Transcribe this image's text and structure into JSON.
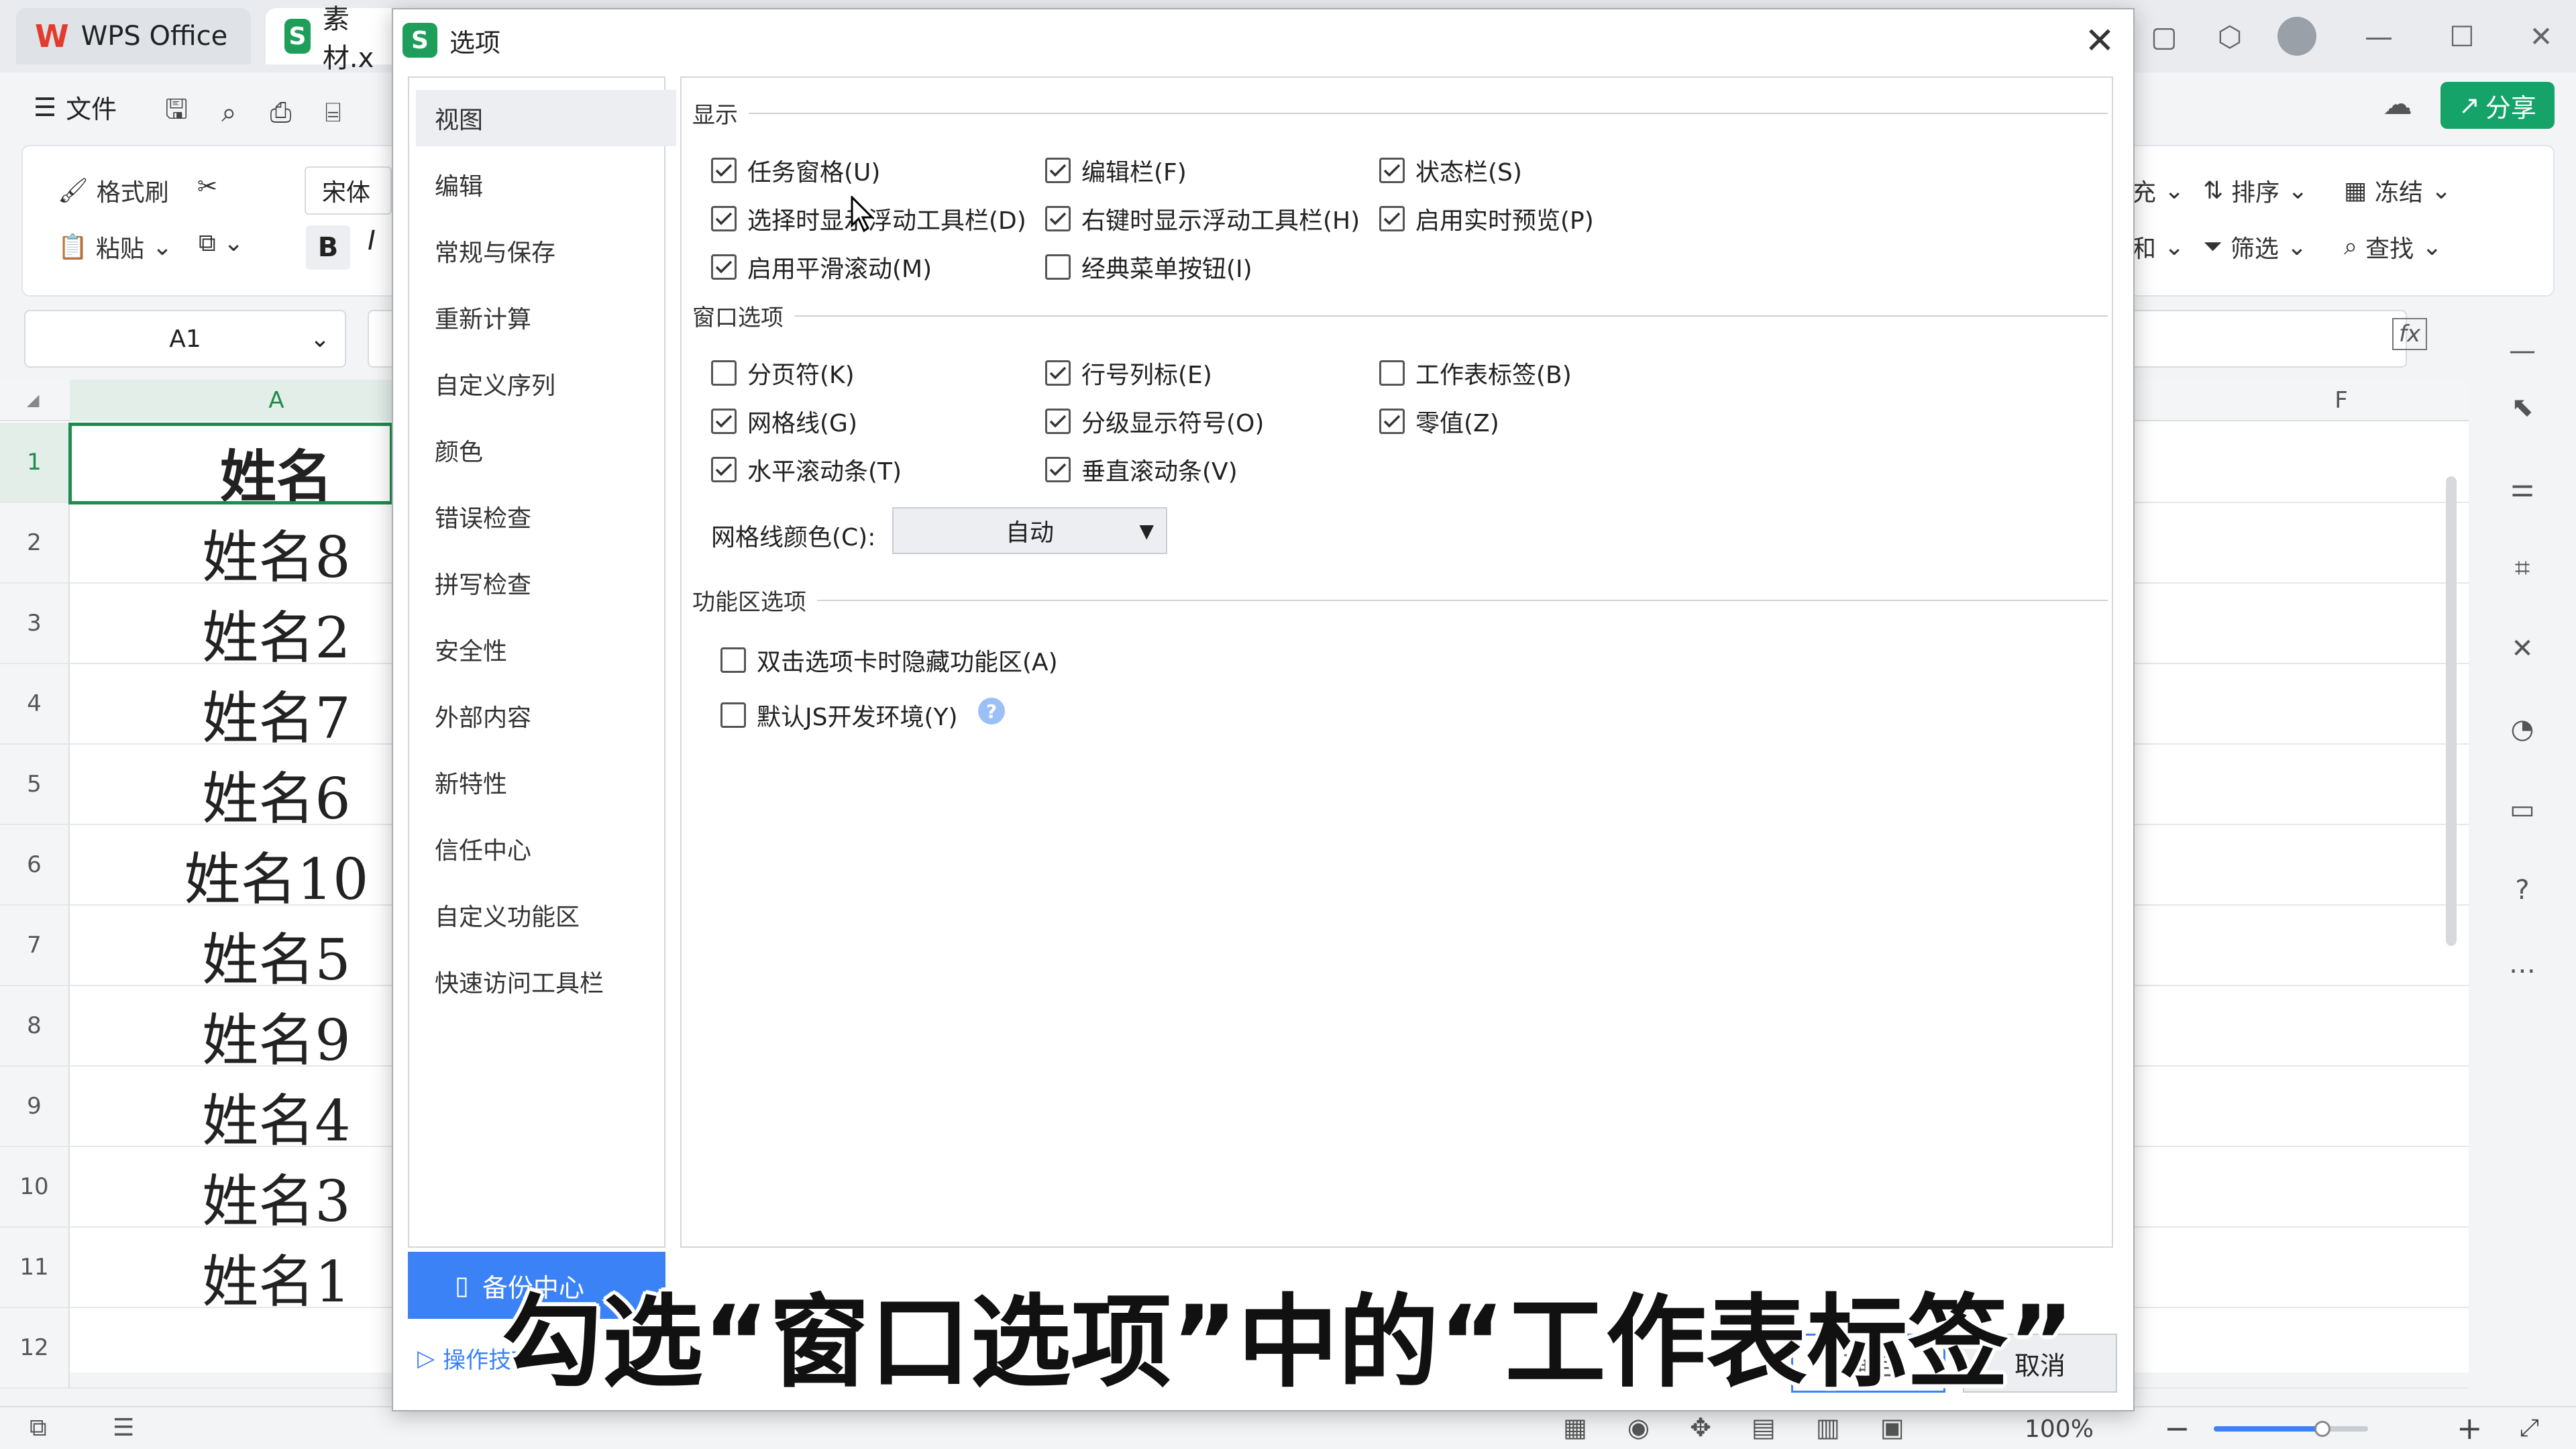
{
  "app": {
    "tabs": [
      {
        "label": "WPS Office"
      },
      {
        "label": "素材.x"
      }
    ],
    "menu_label": "文件",
    "share_label": "分享"
  },
  "ribbon": {
    "format_painter": "格式刷",
    "paste": "粘贴",
    "font_name": "宋体",
    "bold": "B",
    "italic": "I",
    "sort": "排序",
    "freeze": "冻结",
    "filter": "筛选",
    "find": "查找",
    "clipped1": "充",
    "clipped2": "和"
  },
  "formula_bar": {
    "name_box": "A1",
    "fx": "fx"
  },
  "sheet": {
    "col_a": "A",
    "col_f": "F",
    "rows": [
      {
        "num": "1",
        "value": "姓名"
      },
      {
        "num": "2",
        "value": "姓名8"
      },
      {
        "num": "3",
        "value": "姓名2"
      },
      {
        "num": "4",
        "value": "姓名7"
      },
      {
        "num": "5",
        "value": "姓名6"
      },
      {
        "num": "6",
        "value": "姓名10"
      },
      {
        "num": "7",
        "value": "姓名5"
      },
      {
        "num": "8",
        "value": "姓名9"
      },
      {
        "num": "9",
        "value": "姓名4"
      },
      {
        "num": "10",
        "value": "姓名3"
      },
      {
        "num": "11",
        "value": "姓名1"
      },
      {
        "num": "12",
        "value": ""
      }
    ]
  },
  "status": {
    "zoom": "100%"
  },
  "dialog": {
    "title": "选项",
    "nav": [
      "视图",
      "编辑",
      "常规与保存",
      "重新计算",
      "自定义序列",
      "颜色",
      "错误检查",
      "拼写检查",
      "安全性",
      "外部内容",
      "新特性",
      "信任中心",
      "自定义功能区",
      "快速访问工具栏"
    ],
    "backup_label": "备份中心",
    "tips_label": "操作技巧",
    "sections": {
      "display": "显示",
      "window": "窗口选项",
      "ribbon": "功能区选项"
    },
    "display_options": [
      {
        "label": "任务窗格(U)",
        "checked": true
      },
      {
        "label": "编辑栏(F)",
        "checked": true
      },
      {
        "label": "状态栏(S)",
        "checked": true
      },
      {
        "label": "选择时显示浮动工具栏(D)",
        "checked": true
      },
      {
        "label": "右键时显示浮动工具栏(H)",
        "checked": true
      },
      {
        "label": "启用实时预览(P)",
        "checked": true
      },
      {
        "label": "启用平滑滚动(M)",
        "checked": true
      },
      {
        "label": "经典菜单按钮(I)",
        "checked": false
      }
    ],
    "window_options": [
      {
        "label": "分页符(K)",
        "checked": false
      },
      {
        "label": "行号列标(E)",
        "checked": true
      },
      {
        "label": "工作表标签(B)",
        "checked": false
      },
      {
        "label": "网格线(G)",
        "checked": true
      },
      {
        "label": "分级显示符号(O)",
        "checked": true
      },
      {
        "label": "零值(Z)",
        "checked": true
      },
      {
        "label": "水平滚动条(T)",
        "checked": true
      },
      {
        "label": "垂直滚动条(V)",
        "checked": true
      }
    ],
    "gridline_color_label": "网格线颜色(C):",
    "gridline_color_value": "自动",
    "ribbon_options": [
      {
        "label": "双击选项卡时隐藏功能区(A)",
        "checked": false
      },
      {
        "label": "默认JS开发环境(Y)",
        "checked": false
      }
    ],
    "ok_label": "确定",
    "cancel_label": "取消"
  },
  "subtitle": "勾选“窗口选项”中的“工作表标签”"
}
